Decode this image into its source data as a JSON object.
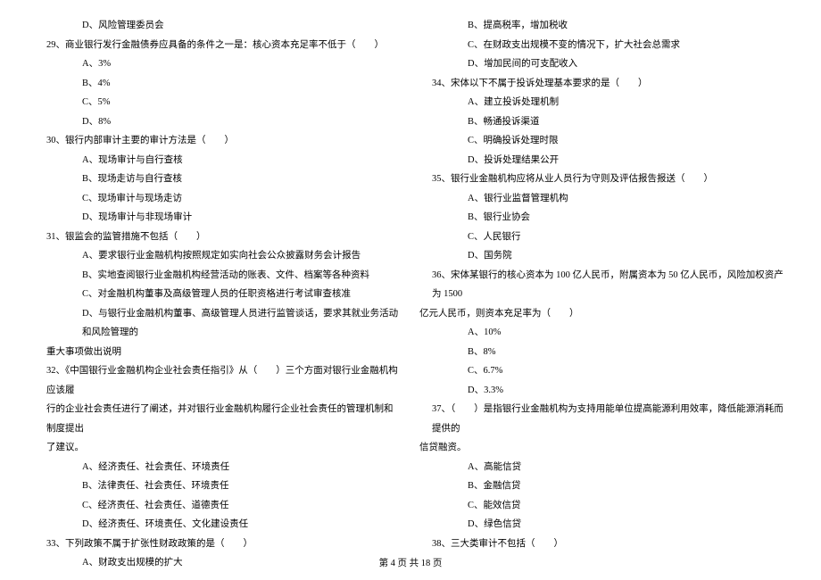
{
  "left": {
    "l01": "D、风险管理委员会",
    "l02": "29、商业银行发行金融债券应具备的条件之一是：核心资本充足率不低于（　　）",
    "l03": "A、3%",
    "l04": "B、4%",
    "l05": "C、5%",
    "l06": "D、8%",
    "l07": "30、银行内部审计主要的审计方法是（　　）",
    "l08": "A、现场审计与自行查核",
    "l09": "B、现场走访与自行查核",
    "l10": "C、现场审计与现场走访",
    "l11": "D、现场审计与非现场审计",
    "l12": "31、银监会的监管措施不包括（　　）",
    "l13": "A、要求银行业金融机构按照规定如实向社会公众披露财务会计报告",
    "l14": "B、实地查阅银行业金融机构经营活动的账表、文件、档案等各种资料",
    "l15": "C、对金融机构董事及高级管理人员的任职资格进行考试审查核准",
    "l16": "D、与银行业金融机构董事、高级管理人员进行监管谈话，要求其就业务活动和风险管理的",
    "l17": "重大事项做出说明",
    "l18": "32、《中国银行业金融机构企业社会责任指引》从（　　）三个方面对银行业金融机构应该履",
    "l19": "行的企业社会责任进行了阐述，并对银行业金融机构履行企业社会责任的管理机制和制度提出",
    "l20": "了建议。",
    "l21": "A、经济责任、社会责任、环境责任",
    "l22": "B、法律责任、社会责任、环境责任",
    "l23": "C、经济责任、社会责任、道德责任",
    "l24": "D、经济责任、环境责任、文化建设责任",
    "l25": "33、下列政策不属于扩张性财政政策的是（　　）",
    "l26": "A、财政支出规模的扩大"
  },
  "right": {
    "r01": "B、提高税率，增加税收",
    "r02": "C、在财政支出规模不变的情况下，扩大社会总需求",
    "r03": "D、增加民间的可支配收入",
    "r04": "34、宋体以下不属于投诉处理基本要求的是（　　）",
    "r05": "A、建立投诉处理机制",
    "r06": "B、畅通投诉渠道",
    "r07": "C、明确投诉处理时限",
    "r08": "D、投诉处理结果公开",
    "r09": "35、银行业金融机构应将从业人员行为守则及评估报告报送（　　）",
    "r10": "A、银行业监督管理机构",
    "r11": "B、银行业协会",
    "r12": "C、人民银行",
    "r13": "D、国务院",
    "r14": "36、宋体某银行的核心资本为 100 亿人民币，附属资本为 50 亿人民币，风险加权资产为 1500",
    "r15": "亿元人民币，则资本充足率为（　　）",
    "r16": "A、10%",
    "r17": "B、8%",
    "r18": "C、6.7%",
    "r19": "D、3.3%",
    "r20": "37、（　　）是指银行业金融机构为支持用能单位提高能源利用效率，降低能源消耗而提供的",
    "r21": "信贷融资。",
    "r22": "A、高能信贷",
    "r23": "B、金融信贷",
    "r24": "C、能效信贷",
    "r25": "D、绿色信贷",
    "r26": "38、三大类审计不包括（　　）"
  },
  "footer": "第 4 页 共 18 页"
}
